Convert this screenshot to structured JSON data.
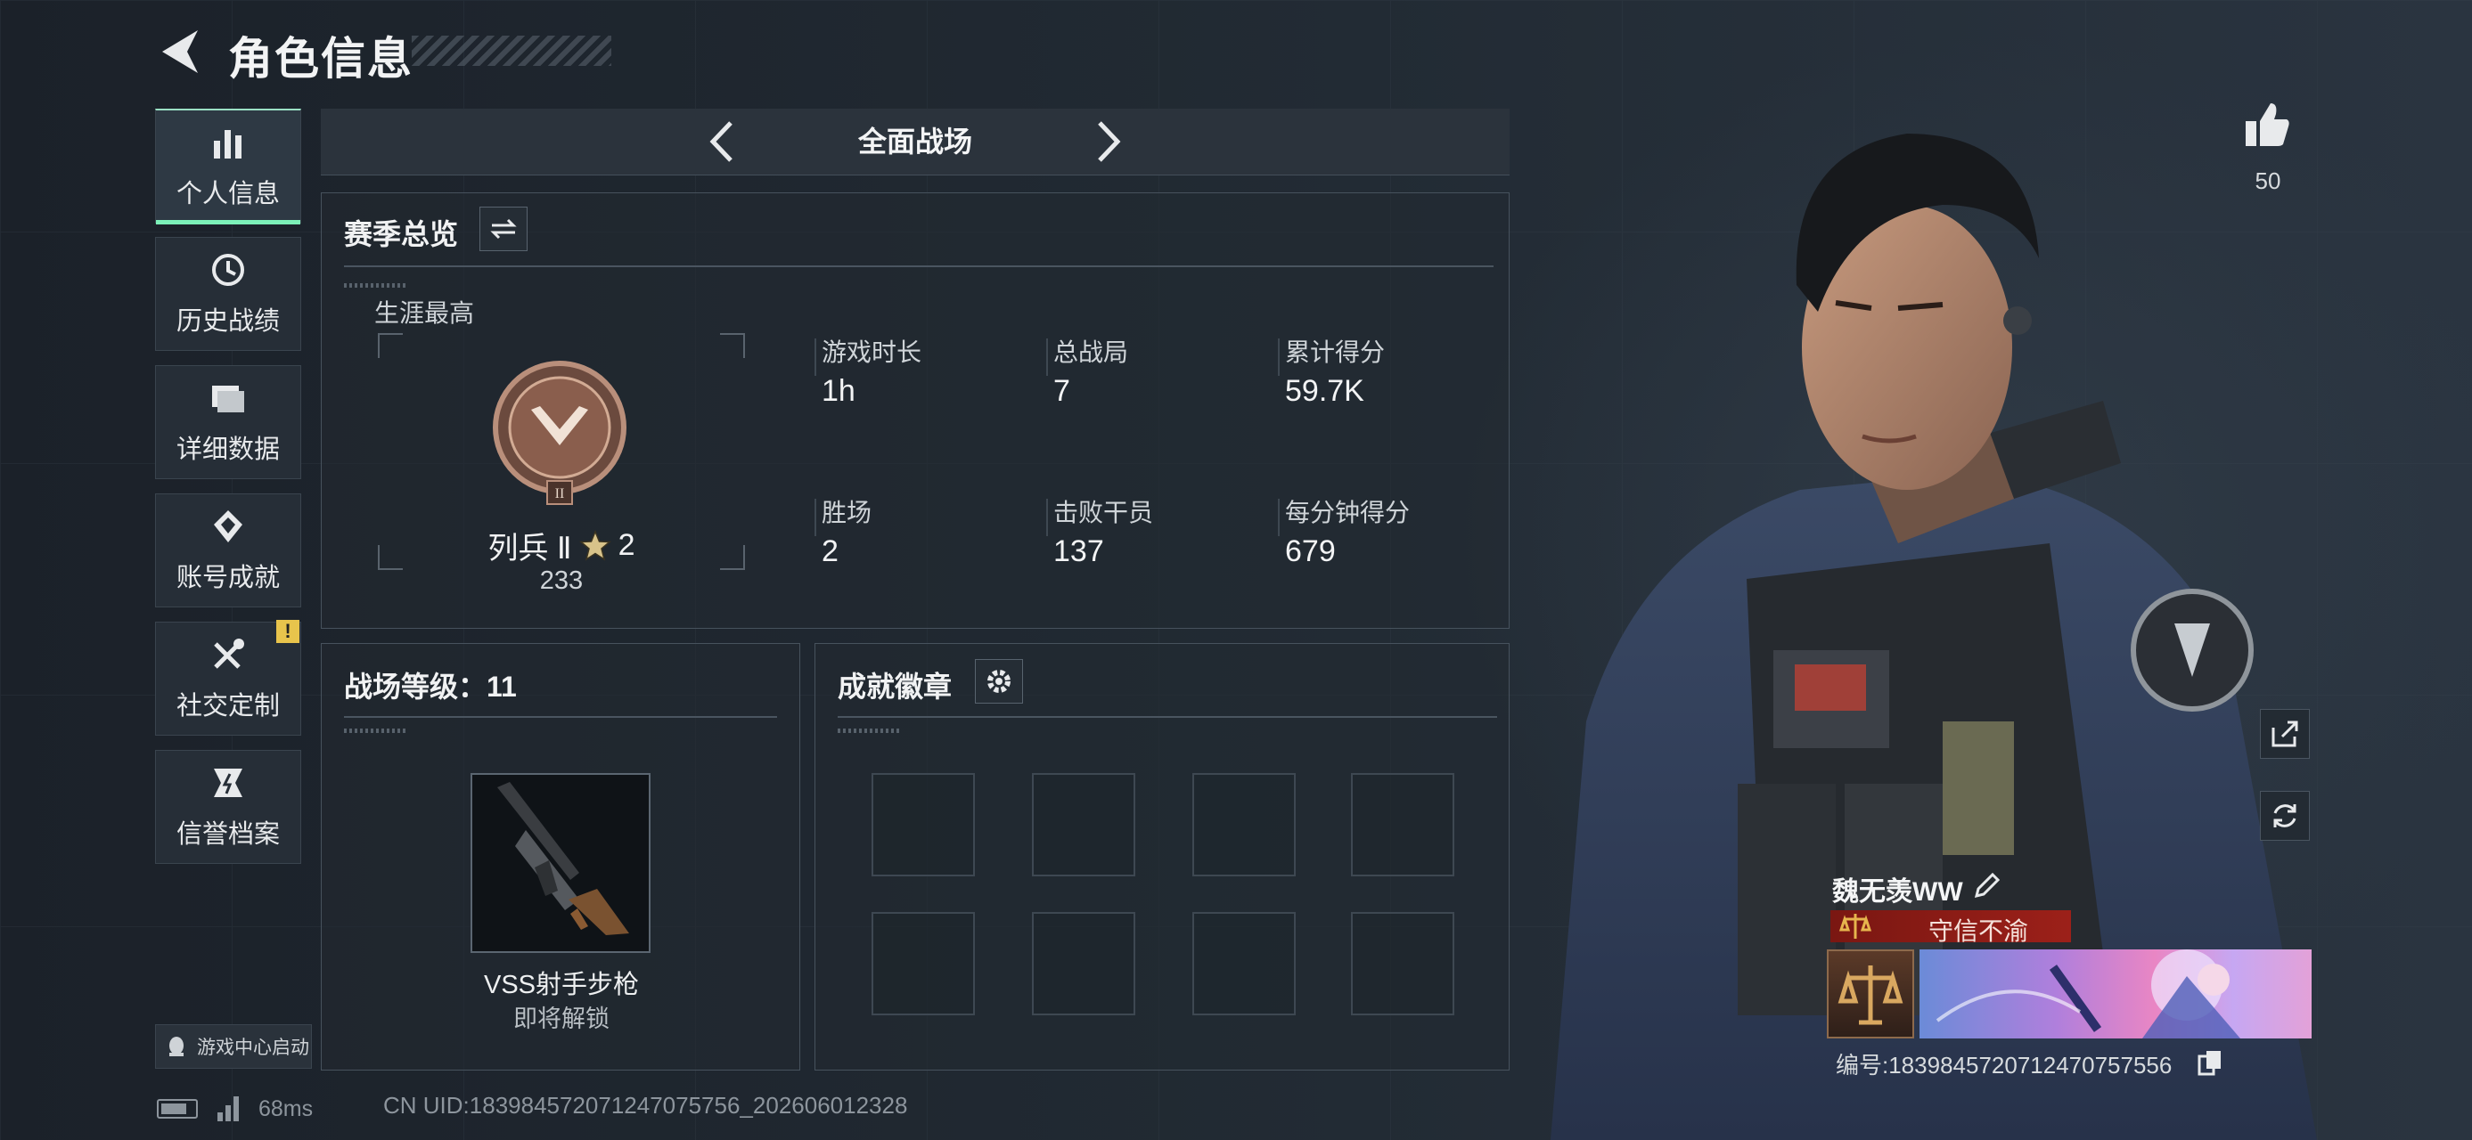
{
  "header": {
    "title": "角色信息"
  },
  "sidebar": {
    "items": [
      {
        "label": "个人信息",
        "icon": "bar-chart-icon"
      },
      {
        "label": "历史战绩",
        "icon": "history-icon"
      },
      {
        "label": "详细数据",
        "icon": "folder-icon"
      },
      {
        "label": "账号成就",
        "icon": "achievement-icon"
      },
      {
        "label": "社交定制",
        "icon": "tools-icon"
      },
      {
        "label": "信誉档案",
        "icon": "credit-icon"
      }
    ],
    "warning_badge": "!",
    "launch_label": "游戏中心启动"
  },
  "mode_bar": {
    "mode": "全面战场"
  },
  "season": {
    "title": "赛季总览",
    "career_best_label": "生涯最高",
    "rank_name": "列兵 Ⅱ",
    "rank_stars": "2",
    "rank_points": "233",
    "rank_roman": "II",
    "stats": [
      {
        "label": "游戏时长",
        "value": "1h"
      },
      {
        "label": "总战局",
        "value": "7"
      },
      {
        "label": "累计得分",
        "value": "59.7K"
      },
      {
        "label": "胜场",
        "value": "2"
      },
      {
        "label": "击败干员",
        "value": "137"
      },
      {
        "label": "每分钟得分",
        "value": "679"
      }
    ]
  },
  "battle_level": {
    "title": "战场等级：11",
    "weapon_name": "VSS射手步枪",
    "weapon_status": "即将解锁"
  },
  "badges": {
    "title": "成就徽章"
  },
  "profile": {
    "likes": "50",
    "player_name": "魏无羡WW",
    "honor_title": "守信不渝",
    "id_text": "编号:1839845720712470757556"
  },
  "status_bar": {
    "ping": "68ms",
    "uid": "CN UID:1839845720712470757​56_202606012328"
  },
  "colors": {
    "accent": "#7cf0b8",
    "honor_red": "#9c2019",
    "warning": "#e8c44c"
  }
}
